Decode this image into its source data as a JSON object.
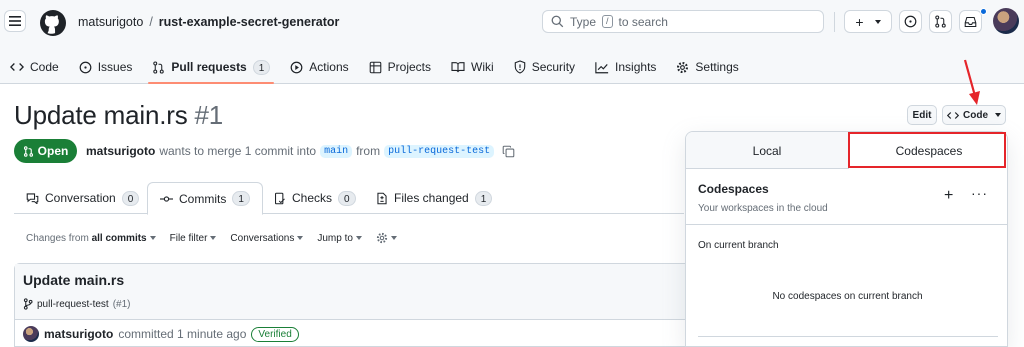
{
  "header": {
    "owner": "matsurigoto",
    "separator": "/",
    "repo": "rust-example-secret-generator",
    "search_placeholder": "Type",
    "search_key": "/",
    "search_suffix": "to search"
  },
  "nav": [
    {
      "label": "Code",
      "icon": "code-icon"
    },
    {
      "label": "Issues",
      "icon": "issue-icon"
    },
    {
      "label": "Pull requests",
      "icon": "pull-request-icon",
      "count": "1",
      "active": true
    },
    {
      "label": "Actions",
      "icon": "play-icon"
    },
    {
      "label": "Projects",
      "icon": "table-icon"
    },
    {
      "label": "Wiki",
      "icon": "book-icon"
    },
    {
      "label": "Security",
      "icon": "shield-icon"
    },
    {
      "label": "Insights",
      "icon": "graph-icon"
    },
    {
      "label": "Settings",
      "icon": "gear-icon"
    }
  ],
  "pr": {
    "title": "Update main.rs",
    "number": "#1",
    "state": "Open",
    "author": "matsurigoto",
    "meta_text": "wants to merge 1 commit into",
    "base_branch": "main",
    "from_text": "from",
    "head_branch": "pull-request-test"
  },
  "actions": {
    "edit": "Edit",
    "code": "Code"
  },
  "tabs": [
    {
      "label": "Conversation",
      "count": "0"
    },
    {
      "label": "Commits",
      "count": "1",
      "active": true
    },
    {
      "label": "Checks",
      "count": "0"
    },
    {
      "label": "Files changed",
      "count": "1"
    }
  ],
  "filters": {
    "changes_from": "Changes from",
    "all_commits": "all commits",
    "file_filter": "File filter",
    "conversations": "Conversations",
    "jump_to": "Jump to"
  },
  "commit": {
    "title": "Update main.rs",
    "branch": "pull-request-test",
    "pr_ref": "(#1)",
    "author": "matsurigoto",
    "action": "committed 1 minute ago",
    "verified": "Verified"
  },
  "dropdown": {
    "tab_local": "Local",
    "tab_codespaces": "Codespaces",
    "title": "Codespaces",
    "subtitle": "Your workspaces in the cloud",
    "plus": "+",
    "more": "···",
    "section": "On current branch",
    "empty": "No codespaces on current branch"
  },
  "colors": {
    "accent": "#0969da",
    "open_green": "#1a7f37",
    "nav_underline": "#fd8c73",
    "annotation_red": "#e5252a"
  }
}
